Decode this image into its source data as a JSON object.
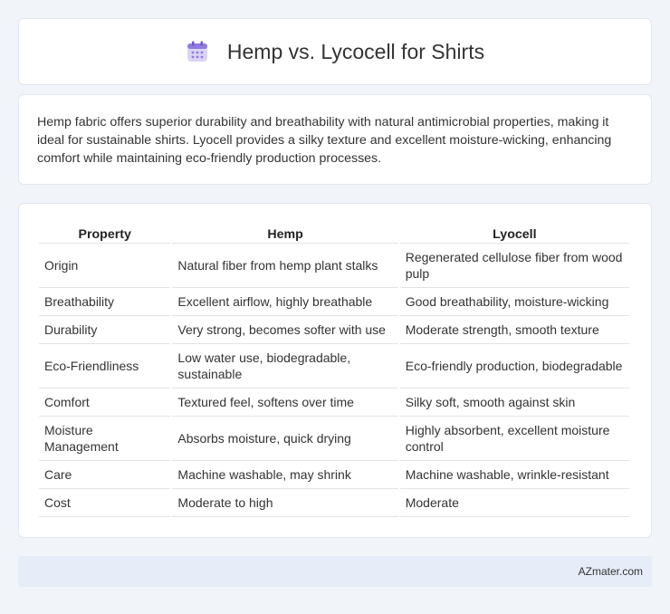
{
  "header": {
    "title": "Hemp vs. Lycocell for Shirts",
    "icon": "calendar-icon"
  },
  "intro": {
    "text": "Hemp fabric offers superior durability and breathability with natural antimicrobial properties, making it ideal for sustainable shirts. Lyocell provides a silky texture and excellent moisture-wicking, enhancing comfort while maintaining eco-friendly production processes."
  },
  "table": {
    "headers": [
      "Property",
      "Hemp",
      "Lyocell"
    ],
    "rows": [
      [
        "Origin",
        "Natural fiber from hemp plant stalks",
        "Regenerated cellulose fiber from wood pulp"
      ],
      [
        "Breathability",
        "Excellent airflow, highly breathable",
        "Good breathability, moisture-wicking"
      ],
      [
        "Durability",
        "Very strong, becomes softer with use",
        "Moderate strength, smooth texture"
      ],
      [
        "Eco-Friendliness",
        "Low water use, biodegradable, sustainable",
        "Eco-friendly production, biodegradable"
      ],
      [
        "Comfort",
        "Textured feel, softens over time",
        "Silky soft, smooth against skin"
      ],
      [
        "Moisture Management",
        "Absorbs moisture, quick drying",
        "Highly absorbent, excellent moisture control"
      ],
      [
        "Care",
        "Machine washable, may shrink",
        "Machine washable, wrinkle-resistant"
      ],
      [
        "Cost",
        "Moderate to high",
        "Moderate"
      ]
    ]
  },
  "footer": {
    "brand": "AZmater.com"
  }
}
